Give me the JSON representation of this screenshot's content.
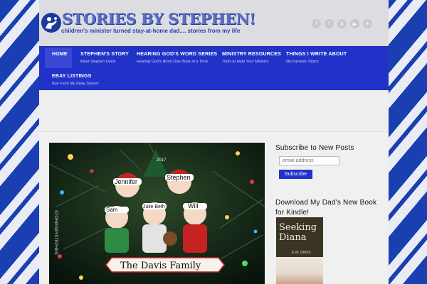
{
  "site": {
    "logo_text": "STORIES BY STEPHEN!",
    "tagline": "children's minister turned stay-at-home dad.... stories from my life"
  },
  "social_icons": [
    "facebook-icon",
    "twitter-icon",
    "pinterest-icon",
    "youtube-icon",
    "linkedin-icon"
  ],
  "nav": {
    "items": [
      {
        "label": "HOME",
        "sub": ""
      },
      {
        "label": "STEPHEN'S STORY",
        "sub": "Meet Stephen Davis"
      },
      {
        "label": "HEARING GOD'S WORD SERIES",
        "sub": "Hearing God's Word One Book at a Time"
      },
      {
        "label": "MINISTRY RESOURCES",
        "sub": "Tools to Help Your Ministry"
      },
      {
        "label": "THINGS I WRITE ABOUT",
        "sub": "My Favorite Topics"
      },
      {
        "label": "EBAY LISTINGS",
        "sub": "Buy From My Ebay Stores!"
      }
    ]
  },
  "photo": {
    "names": [
      "Jennifer",
      "Stephen",
      "Sam",
      "Julie Beth",
      "Will"
    ],
    "year": "2017",
    "banner": "The Davis Family",
    "watermark": "STORIESBYSTEPHEN"
  },
  "sidebar": {
    "subscribe_title": "Subscribe to New Posts",
    "email_placeholder": "email address",
    "subscribe_button": "Subscribe",
    "book_title": "Download My Dad's New Book for Kindle!",
    "book": {
      "title_line1": "Seeking",
      "title_line2": "Diana",
      "author": "E.W. DAVIS"
    }
  },
  "colors": {
    "nav": "#2132c9",
    "accent": "#1b3a9c"
  }
}
